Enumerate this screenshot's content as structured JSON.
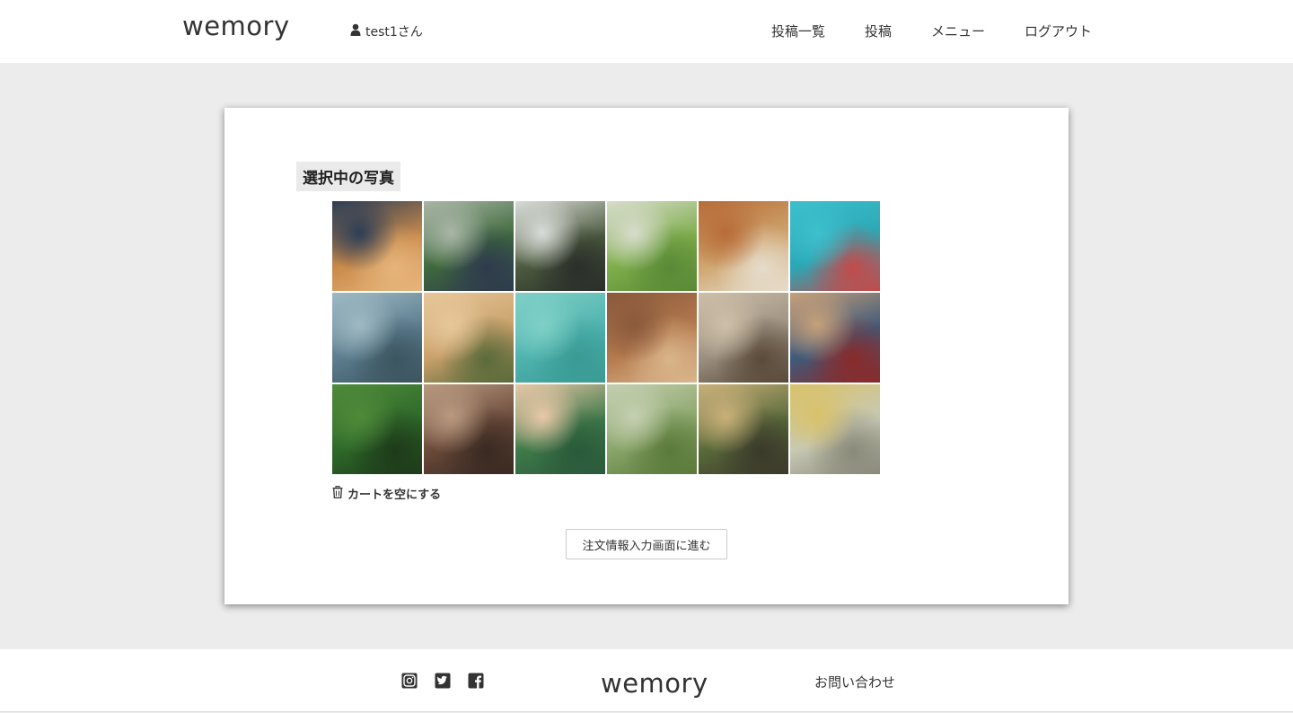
{
  "header": {
    "logo": "wemory",
    "user": "test1さん",
    "nav": [
      "投稿一覧",
      "投稿",
      "メニュー",
      "ログアウト"
    ]
  },
  "main": {
    "title": "選択中の写真",
    "photos": [
      {
        "scene": "sky-clouds-sunset",
        "colors": [
          "#c98a4a",
          "#2d3e56",
          "#e6b47a"
        ]
      },
      {
        "scene": "couple-on-bench-greenery",
        "colors": [
          "#3f6a3c",
          "#a9b6a6",
          "#2e3a4e"
        ]
      },
      {
        "scene": "bride-dancing-forest",
        "colors": [
          "#4d5b3f",
          "#d9dcd8",
          "#2a2f2a"
        ]
      },
      {
        "scene": "wedding-chairs-meadow",
        "colors": [
          "#7fae4c",
          "#d7dccb",
          "#5a8a36"
        ]
      },
      {
        "scene": "family-in-flower-field",
        "colors": [
          "#cfa56e",
          "#b86c38",
          "#e6dccb"
        ]
      },
      {
        "scene": "hot-air-balloons",
        "colors": [
          "#2aa7b6",
          "#3dbfcc",
          "#c44a4a"
        ]
      },
      {
        "scene": "mountain-lake-pier",
        "colors": [
          "#5c7d8e",
          "#9eb9c3",
          "#3c5560"
        ]
      },
      {
        "scene": "father-and-child-sunset",
        "colors": [
          "#c9a06a",
          "#e7c79a",
          "#5a6a3a"
        ]
      },
      {
        "scene": "boat-turquoise-water",
        "colors": [
          "#4fb3ad",
          "#7fd0c7",
          "#3a9a94"
        ]
      },
      {
        "scene": "elderly-couple-street",
        "colors": [
          "#b57a4e",
          "#8a5a3c",
          "#d9b48a"
        ]
      },
      {
        "scene": "elderly-couple-alley",
        "colors": [
          "#9b8f80",
          "#cdbfa8",
          "#5a4a3a"
        ]
      },
      {
        "scene": "smiling-elderly-couple",
        "colors": [
          "#3f5a7a",
          "#c6a07a",
          "#8a2a2a"
        ]
      },
      {
        "scene": "child-in-forest",
        "colors": [
          "#2e6a2a",
          "#4f8a3a",
          "#1e3a1a"
        ]
      },
      {
        "scene": "two-children-hugging",
        "colors": [
          "#6a4a3a",
          "#b99a80",
          "#3a2a22"
        ]
      },
      {
        "scene": "child-face-paint",
        "colors": [
          "#3f7a4a",
          "#e9c8a8",
          "#2a5a3a"
        ]
      },
      {
        "scene": "kids-playing-park",
        "colors": [
          "#8aa56a",
          "#c4cfb0",
          "#5a7a3a"
        ]
      },
      {
        "scene": "girl-sunlit-field",
        "colors": [
          "#5a6a3a",
          "#c9b07a",
          "#3a3a2a"
        ]
      },
      {
        "scene": "vintage-car-woman",
        "colors": [
          "#c7c9b5",
          "#d9c26a",
          "#8a8a7a"
        ]
      }
    ],
    "clear_cart": "カートを空にする",
    "proceed": "注文情報入力画面に進む"
  },
  "footer": {
    "social": [
      "instagram-icon",
      "twitter-icon",
      "facebook-icon"
    ],
    "logo": "wemory",
    "contact": "お問い合わせ"
  }
}
